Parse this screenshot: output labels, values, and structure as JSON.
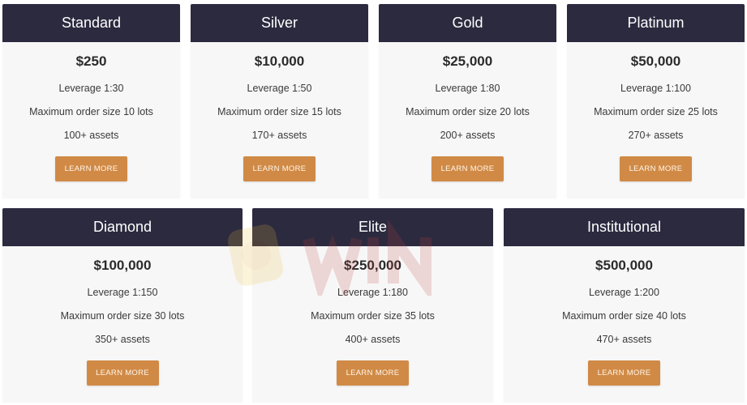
{
  "plans": [
    {
      "name": "Standard",
      "price": "$250",
      "leverage": "Leverage 1:30",
      "order_size": "Maximum order size 10 lots",
      "assets": "100+ assets",
      "button": "LEARN MORE"
    },
    {
      "name": "Silver",
      "price": "$10,000",
      "leverage": "Leverage 1:50",
      "order_size": "Maximum order size  15 lots",
      "assets": "170+ assets",
      "button": "LEARN MORE"
    },
    {
      "name": "Gold",
      "price": "$25,000",
      "leverage": "Leverage 1:80",
      "order_size": "Maximum order size 20 lots",
      "assets": "200+ assets",
      "button": "LEARN MORE"
    },
    {
      "name": "Platinum",
      "price": "$50,000",
      "leverage": "Leverage 1:100",
      "order_size": "Maximum order size 25 lots",
      "assets": "270+ assets",
      "button": "LEARN MORE"
    },
    {
      "name": "Diamond",
      "price": "$100,000",
      "leverage": "Leverage 1:150",
      "order_size": "Maximum order size 30 lots",
      "assets": "350+ assets",
      "button": "LEARN MORE"
    },
    {
      "name": "Elite",
      "price": "$250,000",
      "leverage": "Leverage 1:180",
      "order_size": "Maximum order size 35 lots",
      "assets": "400+ assets",
      "button": "LEARN MORE"
    },
    {
      "name": "Institutional",
      "price": "$500,000",
      "leverage": "Leverage 1:200",
      "order_size": "Maximum order size 40 lots",
      "assets": "470+ assets",
      "button": "LEARN MORE"
    }
  ],
  "colors": {
    "header": "#2c2a3f",
    "button": "#d08a46",
    "card": "#f7f7f7"
  }
}
